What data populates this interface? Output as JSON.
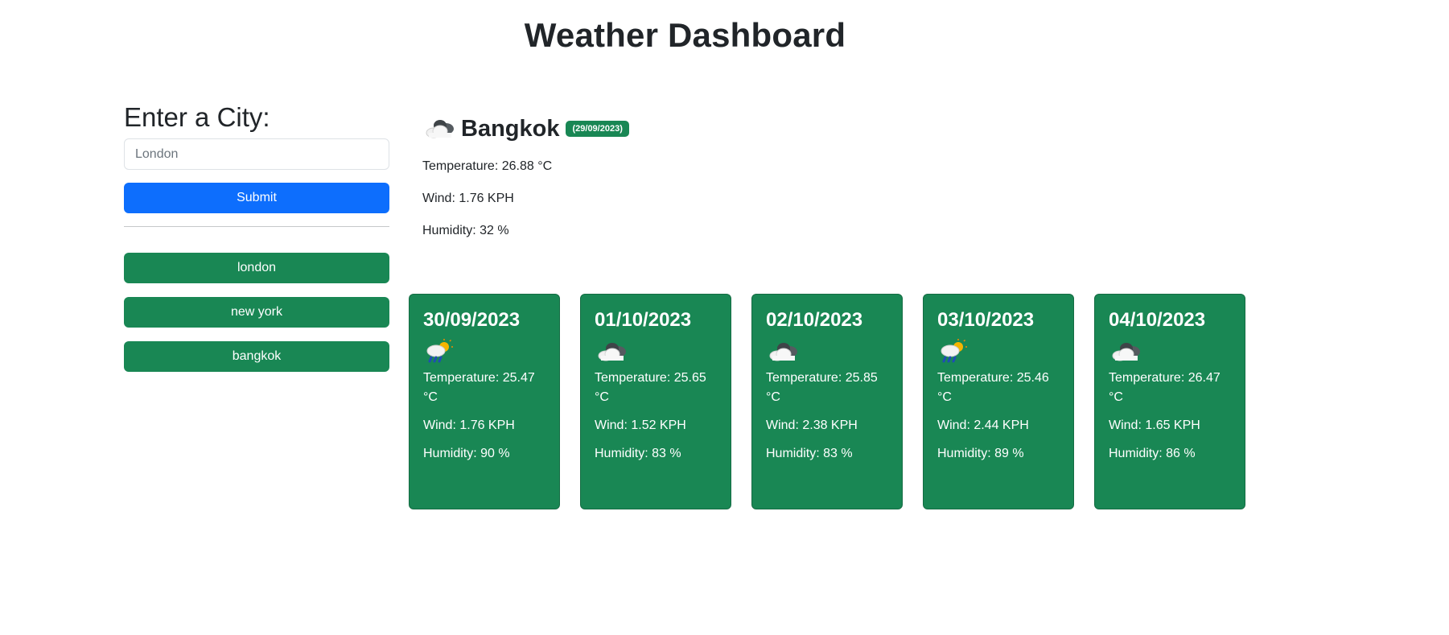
{
  "page": {
    "title": "Weather Dashboard"
  },
  "sidebar": {
    "heading": "Enter a City:",
    "input_placeholder": "London",
    "input_value": "",
    "submit_label": "Submit",
    "history": [
      "london",
      "new york",
      "bangkok"
    ]
  },
  "current": {
    "icon": "cloudy-icon",
    "city": "Bangkok",
    "date": "(29/09/2023)",
    "temperature": "Temperature: 26.88 °C",
    "wind": "Wind: 1.76 KPH",
    "humidity": "Humidity: 32 %"
  },
  "forecast": [
    {
      "date": "30/09/2023",
      "icon": "rain-sun-icon",
      "temperature": "Temperature: 25.47 °C",
      "wind": "Wind: 1.76 KPH",
      "humidity": "Humidity: 90 %"
    },
    {
      "date": "01/10/2023",
      "icon": "cloudy-icon",
      "temperature": "Temperature: 25.65 °C",
      "wind": "Wind: 1.52 KPH",
      "humidity": "Humidity: 83 %"
    },
    {
      "date": "02/10/2023",
      "icon": "cloudy-icon",
      "temperature": "Temperature: 25.85 °C",
      "wind": "Wind: 2.38 KPH",
      "humidity": "Humidity: 83 %"
    },
    {
      "date": "03/10/2023",
      "icon": "rain-sun-icon",
      "temperature": "Temperature: 25.46 °C",
      "wind": "Wind: 2.44 KPH",
      "humidity": "Humidity: 89 %"
    },
    {
      "date": "04/10/2023",
      "icon": "cloudy-icon",
      "temperature": "Temperature: 26.47 °C",
      "wind": "Wind: 1.65 KPH",
      "humidity": "Humidity: 86 %"
    }
  ],
  "colors": {
    "primary": "#0d6efd",
    "success": "#198754",
    "text": "#212529"
  }
}
